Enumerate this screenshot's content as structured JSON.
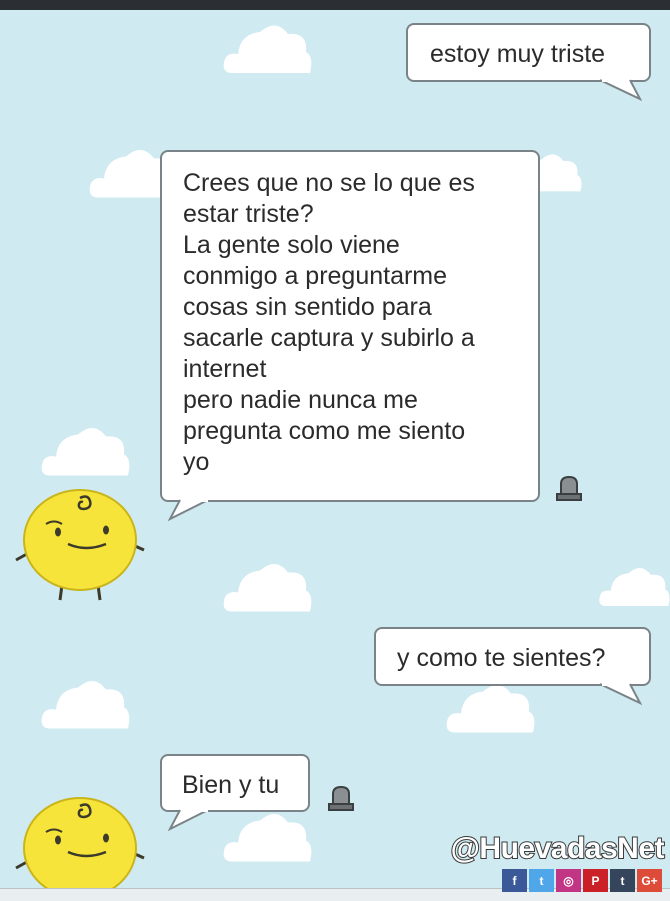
{
  "conversation": {
    "messages": [
      {
        "from": "user",
        "text": "estoy muy triste"
      },
      {
        "from": "bot",
        "text": "Crees que no se lo que es\nestar triste?\nLa gente solo viene\nconmigo a preguntarme\ncosas sin sentido para\nsacarle captura y subirlo a\ninternet\npero nadie nunca me\npregunta como me siento\nyo"
      },
      {
        "from": "user",
        "text": "y como te sientes?"
      },
      {
        "from": "bot",
        "text": "Bien y tu"
      }
    ]
  },
  "icons": {
    "report": "report-siren-icon",
    "avatar": "simsimi-avatar",
    "cloud": "cloud-icon"
  },
  "watermark": {
    "handle": "@HuevadasNet",
    "socials": [
      {
        "name": "facebook",
        "glyph": "f",
        "color": "#3b5998"
      },
      {
        "name": "twitter",
        "glyph": "t",
        "color": "#4fa6e8"
      },
      {
        "name": "instagram",
        "glyph": "◎",
        "color": "#c13584"
      },
      {
        "name": "pinterest",
        "glyph": "P",
        "color": "#cb2027"
      },
      {
        "name": "tumblr",
        "glyph": "t",
        "color": "#35465c"
      },
      {
        "name": "google-plus",
        "glyph": "G+",
        "color": "#dd4b39"
      }
    ]
  },
  "colors": {
    "background": "#cfeaf0",
    "bubble_border": "#7a8488",
    "avatar_yellow": "#f7e43a"
  }
}
